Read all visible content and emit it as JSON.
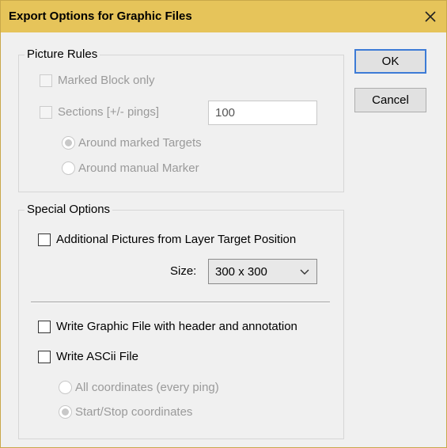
{
  "window": {
    "title": "Export Options for Graphic Files",
    "close_glyph": "✕"
  },
  "buttons": {
    "ok": "OK",
    "cancel": "Cancel"
  },
  "picture_rules": {
    "legend": "Picture Rules",
    "marked_block_only": {
      "label": "Marked Block only",
      "checked": false,
      "enabled": false
    },
    "sections": {
      "label": "Sections [+/- pings]",
      "checked": false,
      "enabled": false,
      "value": "100"
    },
    "around_marked_targets": {
      "label": "Around marked Targets",
      "selected": true,
      "enabled": false
    },
    "around_manual_marker": {
      "label": "Around manual Marker",
      "selected": false,
      "enabled": false
    }
  },
  "special_options": {
    "legend": "Special Options",
    "additional_pictures": {
      "label": "Additional Pictures from Layer Target Position",
      "checked": false
    },
    "size_label": "Size:",
    "size_value": "300 x 300",
    "write_graphic_file": {
      "label": "Write Graphic File with header and annotation",
      "checked": false
    },
    "write_ascii_file": {
      "label": "Write ASCii File",
      "checked": false
    },
    "all_coordinates": {
      "label": "All coordinates (every ping)",
      "selected": false,
      "enabled": false
    },
    "start_stop_coordinates": {
      "label": "Start/Stop coordinates",
      "selected": true,
      "enabled": false
    }
  },
  "icons": {
    "close": "close-icon",
    "dropdown": "chevron-down-icon"
  },
  "colors": {
    "titlebar": "#e6c45a",
    "default_button_border": "#3d7bd6"
  }
}
